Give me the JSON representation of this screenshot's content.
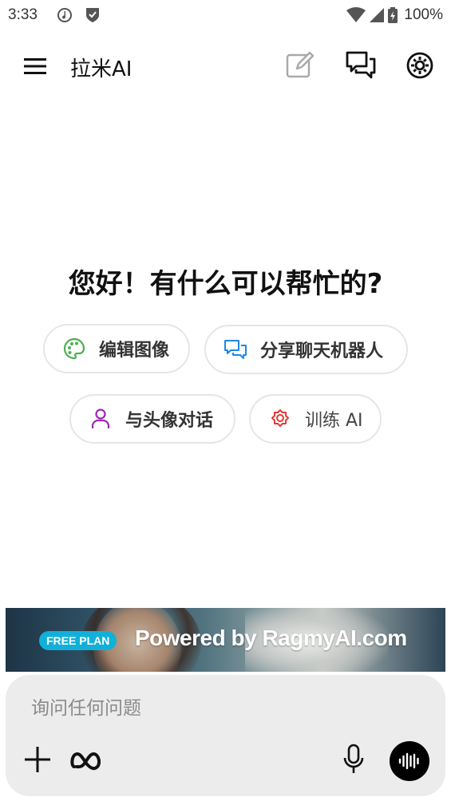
{
  "status_bar": {
    "time": "3:33",
    "battery": "100%"
  },
  "header": {
    "title": "拉米AI",
    "icons": [
      "menu-icon",
      "new-chat-icon",
      "chats-icon",
      "settings-icon"
    ]
  },
  "greeting": "您好！有什么可以帮忙的?",
  "suggestions": [
    {
      "label": "编辑图像",
      "icon": "palette-icon",
      "color": "#4caf50"
    },
    {
      "label": "分享聊天机器人",
      "icon": "chat-bubbles-icon",
      "color": "#1e88e5"
    },
    {
      "label": "与头像对话",
      "icon": "person-icon",
      "color": "#9c27b0"
    },
    {
      "label": "训练 AI",
      "icon": "ai-brain-icon",
      "color": "#e53935"
    }
  ],
  "banner": {
    "badge": "FREE PLAN",
    "text": "Powered by RagmyAI.com"
  },
  "composer": {
    "placeholder": "询问任何问题",
    "value": ""
  },
  "colors": {
    "background": "#ffffff",
    "composer_bg": "#ececec",
    "badge": "#12b0d8",
    "voice_button": "#000000"
  }
}
